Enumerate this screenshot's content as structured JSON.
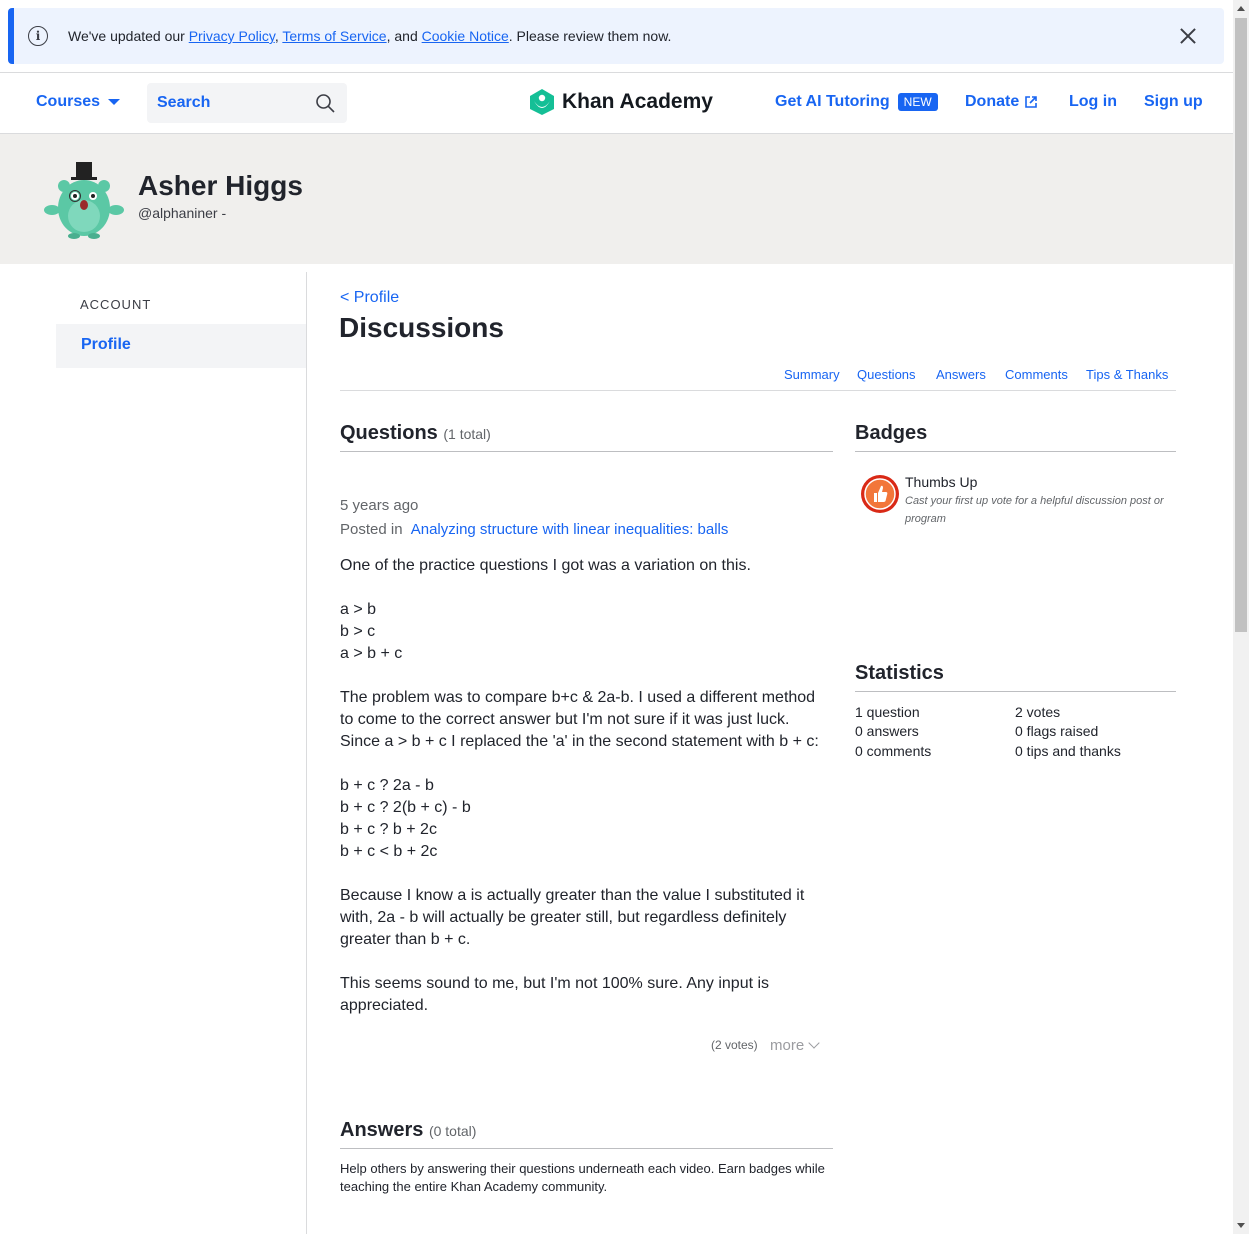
{
  "notice": {
    "prefix": "We've updated our ",
    "privacy": "Privacy Policy",
    "sep1": ", ",
    "terms": "Terms of Service",
    "sep2": ", and ",
    "cookie": "Cookie Notice",
    "suffix": ". Please review them now."
  },
  "header": {
    "courses": "Courses",
    "search_placeholder": "Search",
    "logo_text": "Khan Academy",
    "ai_tutoring": "Get AI Tutoring",
    "new_badge": "NEW",
    "donate": "Donate",
    "login": "Log in",
    "signup": "Sign up"
  },
  "profile": {
    "name": "Asher Higgs",
    "username": "@alphaniner -"
  },
  "sidebar": {
    "section": "ACCOUNT",
    "item": "Profile"
  },
  "main": {
    "back": "< Profile",
    "title": "Discussions",
    "tabs": [
      "Summary",
      "Questions",
      "Answers",
      "Comments",
      "Tips & Thanks"
    ]
  },
  "questions": {
    "title": "Questions",
    "total": "(1 total)",
    "time": "5 years ago",
    "posted_in": "Posted in",
    "topic": "Analyzing structure with linear inequalities: balls",
    "para1": "One of the practice questions I got was a variation on this.",
    "para2": "a > b\nb > c\na > b + c",
    "para3": "The problem was to compare b+c & 2a-b. I used a different method to come to the correct answer but I'm not sure if it was just luck. Since a > b + c I replaced the 'a' in the second statement with b + c:",
    "para4": "b + c ? 2a - b\nb + c ? 2(b + c) - b\nb + c ? b + 2c\nb + c < b + 2c",
    "para5": "Because I know a is actually greater than the value I substituted it with, 2a - b will actually be greater still, but regardless definitely greater than b + c.",
    "para6": "This seems sound to me, but I'm not 100% sure. Any input is appreciated.",
    "votes": "(2 votes)",
    "more": "more"
  },
  "answers": {
    "title": "Answers",
    "total": "(0 total)",
    "note": "Help others by answering their questions underneath each video. Earn badges while teaching the entire Khan Academy community."
  },
  "badges": {
    "title": "Badges",
    "name": "Thumbs Up",
    "desc": "Cast your first up vote for a helpful discussion post or program",
    "icon": "thumbs-up-icon"
  },
  "statistics": {
    "title": "Statistics",
    "left": [
      "1 question",
      "0 answers",
      "0 comments"
    ],
    "right": [
      "2 votes",
      "0 flags raised",
      "0 tips and thanks"
    ]
  },
  "colors": {
    "accent": "#1865f2",
    "notice_bg": "#edf3fe",
    "banner_bg": "#f0efed",
    "logo_green": "#14bf96",
    "badge_red": "#d92916"
  }
}
